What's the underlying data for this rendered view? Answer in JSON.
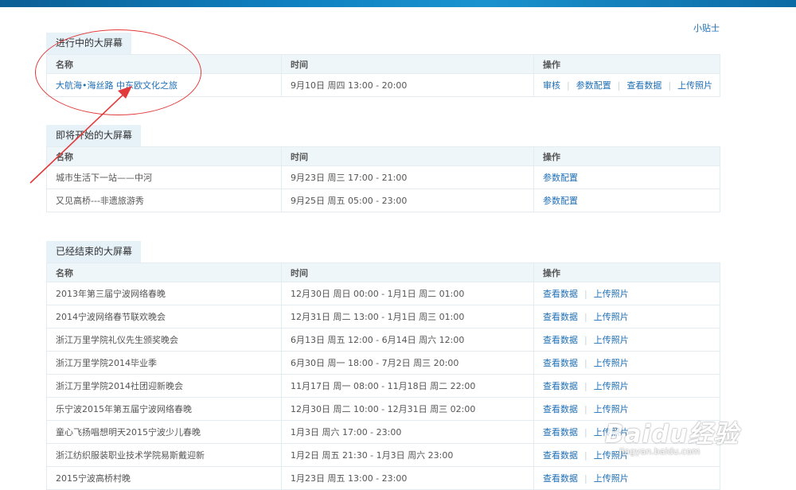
{
  "tip_link": "小贴士",
  "sections": [
    {
      "title": "进行中的大屏幕",
      "headers": [
        "名称",
        "时间",
        "操作"
      ],
      "rows": [
        {
          "name": "大航海•海丝路 中东欧文化之旅",
          "time": "9月10日 周四 13:00 - 20:00",
          "actions": [
            "审核",
            "参数配置",
            "查看数据",
            "上传照片"
          ]
        }
      ]
    },
    {
      "title": "即将开始的大屏幕",
      "headers": [
        "名称",
        "时间",
        "操作"
      ],
      "rows": [
        {
          "name": "城市生活下一站——中河",
          "time": "9月23日 周三 17:00 - 21:00",
          "actions": [
            "参数配置"
          ]
        },
        {
          "name": "又见高桥---非遗旅游秀",
          "time": "9月25日 周五 05:00 - 23:00",
          "actions": [
            "参数配置"
          ]
        }
      ]
    },
    {
      "title": "已经结束的大屏幕",
      "headers": [
        "名称",
        "时间",
        "操作"
      ],
      "rows": [
        {
          "name": "2013年第三届宁波网络春晚",
          "time": "12月30日 周日 00:00 - 1月1日 周二 01:00",
          "actions": [
            "查看数据",
            "上传照片"
          ]
        },
        {
          "name": "2014宁波网络春节联欢晚会",
          "time": "12月31日 周二 13:00 - 1月1日 周三 01:00",
          "actions": [
            "查看数据",
            "上传照片"
          ]
        },
        {
          "name": "浙江万里学院礼仪先生颁奖晚会",
          "time": "6月13日 周五 12:00 - 6月14日 周六 12:00",
          "actions": [
            "查看数据",
            "上传照片"
          ]
        },
        {
          "name": "浙江万里学院2014毕业季",
          "time": "6月30日 周一 18:00 - 7月2日 周三 20:00",
          "actions": [
            "查看数据",
            "上传照片"
          ]
        },
        {
          "name": "浙江万里学院2014社团迎新晚会",
          "time": "11月17日 周一 08:00 - 11月18日 周二 22:00",
          "actions": [
            "查看数据",
            "上传照片"
          ]
        },
        {
          "name": "乐宁波2015年第五届宁波网络春晚",
          "time": "12月30日 周二 10:00 - 12月31日 周三 02:00",
          "actions": [
            "查看数据",
            "上传照片"
          ]
        },
        {
          "name": "童心飞扬唱想明天2015宁波少儿春晚",
          "time": "1月3日 周六 17:00 - 23:00",
          "actions": [
            "查看数据",
            "上传照片"
          ]
        },
        {
          "name": "浙江纺织服装职业技术学院易斯戴迎新",
          "time": "1月2日 周五 21:30 - 1月3日 周六 23:00",
          "actions": [
            "查看数据",
            "上传照片"
          ]
        },
        {
          "name": "2015宁波高桥村晚",
          "time": "1月23日 周五 13:00 - 23:00",
          "actions": [
            "查看数据",
            "上传照片"
          ]
        }
      ]
    }
  ],
  "watermark": {
    "logo": "Baidu经验",
    "url": "jingyan.baidu.com"
  },
  "annotation_color": "#e23a3a"
}
